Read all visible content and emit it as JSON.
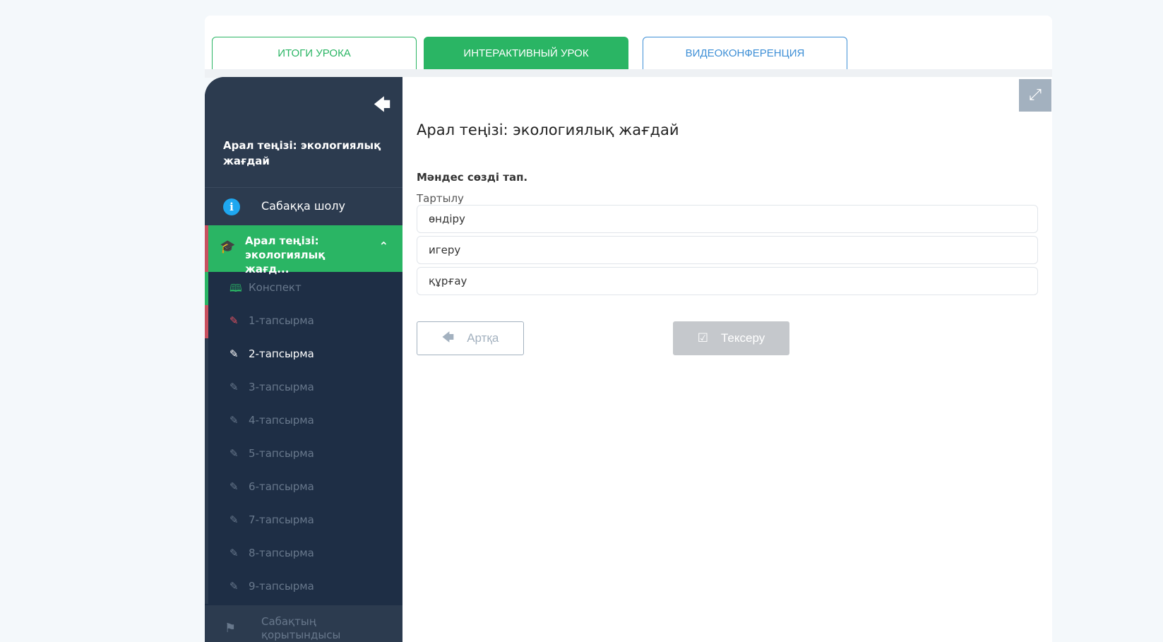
{
  "tabs": [
    {
      "label": "ИТОГИ УРОКА"
    },
    {
      "label": "ИНТЕРАКТИВНЫЙ УРОК"
    },
    {
      "label": "ВИДЕОКОНФЕРЕНЦИЯ"
    }
  ],
  "sidebar": {
    "title": "Арал теңізі: экологиялық жағдай",
    "overview_label": "Сабаққа шолу",
    "lesson_label": "Арал теңізі: экологиялық жағд...",
    "tasks": [
      {
        "label": "Конспект"
      },
      {
        "label": "1-тапсырма"
      },
      {
        "label": "2-тапсырма"
      },
      {
        "label": "3-тапсырма"
      },
      {
        "label": "4-тапсырма"
      },
      {
        "label": "5-тапсырма"
      },
      {
        "label": "6-тапсырма"
      },
      {
        "label": "7-тапсырма"
      },
      {
        "label": "8-тапсырма"
      },
      {
        "label": "9-тапсырма"
      }
    ],
    "results_label": "Сабақтың қорытындысы"
  },
  "main": {
    "title": "Арал теңізі: экологиялық жағдай",
    "prompt": "Мәндес сөзді тап.",
    "word": "Тартылу",
    "options": [
      {
        "label": "өндіру"
      },
      {
        "label": "игеру"
      },
      {
        "label": "құрғау"
      }
    ],
    "back_label": "Артқа",
    "check_label": "Тексеру"
  },
  "colors": {
    "accent_green": "#2ab564",
    "accent_blue": "#3e8fd6",
    "sidebar_bg": "#1e2e45",
    "error_red": "#c8505f"
  }
}
